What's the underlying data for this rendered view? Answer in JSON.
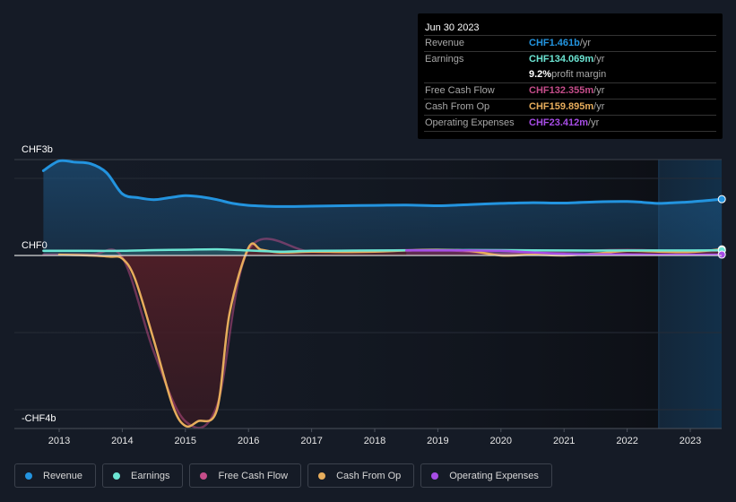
{
  "tooltip": {
    "date": "Jun 30 2023",
    "rows": [
      {
        "label": "Revenue",
        "value": "CHF1.461b",
        "unit": " /yr",
        "color": "#2394df"
      },
      {
        "label": "Earnings",
        "value": "CHF134.069m",
        "unit": " /yr",
        "color": "#6ce5d3"
      },
      {
        "label": "",
        "value": "9.2%",
        "unit": " profit margin",
        "color": "#ffffff"
      },
      {
        "label": "Free Cash Flow",
        "value": "CHF132.355m",
        "unit": " /yr",
        "color": "#c54d8a"
      },
      {
        "label": "Cash From Op",
        "value": "CHF159.895m",
        "unit": " /yr",
        "color": "#e7ad5c"
      },
      {
        "label": "Operating Expenses",
        "value": "CHF23.412m",
        "unit": " /yr",
        "color": "#a74de6"
      }
    ]
  },
  "legend": [
    {
      "label": "Revenue",
      "color": "#2394df"
    },
    {
      "label": "Earnings",
      "color": "#6ce5d3"
    },
    {
      "label": "Free Cash Flow",
      "color": "#c54d8a"
    },
    {
      "label": "Cash From Op",
      "color": "#e7ad5c"
    },
    {
      "label": "Operating Expenses",
      "color": "#a74de6"
    }
  ],
  "chart_data": {
    "type": "area",
    "title": "",
    "xlabel": "",
    "ylabel": "",
    "unit": "CHF billions",
    "y_tick_labels": [
      "CHF3b",
      "CHF0",
      "-CHF4b"
    ],
    "y_ticks": [
      2.5,
      0,
      -4
    ],
    "ylim": [
      -4.5,
      2.5
    ],
    "x_tick_labels": [
      "2013",
      "2014",
      "2015",
      "2016",
      "2017",
      "2018",
      "2019",
      "2020",
      "2021",
      "2022",
      "2023"
    ],
    "xlim": [
      2012.75,
      2023.5
    ],
    "forecast_shade_from": 2022.5,
    "grid": true,
    "legend_position": "bottom",
    "series": [
      {
        "name": "Revenue",
        "color": "#2394df",
        "x": [
          2012.75,
          2013.0,
          2013.25,
          2013.5,
          2013.75,
          2014.0,
          2014.25,
          2014.5,
          2014.75,
          2015.0,
          2015.25,
          2015.5,
          2015.75,
          2016.0,
          2016.5,
          2017.0,
          2017.5,
          2018.0,
          2018.5,
          2019.0,
          2019.5,
          2020.0,
          2020.5,
          2021.0,
          2021.5,
          2022.0,
          2022.25,
          2022.5,
          2022.75,
          2023.0,
          2023.5
        ],
        "values": [
          2.2,
          2.45,
          2.42,
          2.38,
          2.15,
          1.6,
          1.5,
          1.45,
          1.5,
          1.55,
          1.52,
          1.45,
          1.35,
          1.3,
          1.27,
          1.28,
          1.29,
          1.3,
          1.31,
          1.29,
          1.32,
          1.35,
          1.37,
          1.36,
          1.39,
          1.4,
          1.38,
          1.35,
          1.37,
          1.39,
          1.461
        ]
      },
      {
        "name": "Earnings",
        "color": "#6ce5d3",
        "x": [
          2012.75,
          2013.5,
          2014.0,
          2014.5,
          2015.0,
          2015.5,
          2016.0,
          2016.5,
          2017.0,
          2018.0,
          2019.0,
          2020.0,
          2021.0,
          2022.0,
          2023.0,
          2023.5
        ],
        "values": [
          0.12,
          0.12,
          0.12,
          0.14,
          0.15,
          0.16,
          0.13,
          0.1,
          0.12,
          0.13,
          0.14,
          0.14,
          0.13,
          0.13,
          0.13,
          0.134
        ]
      },
      {
        "name": "Free Cash Flow",
        "color": "#c54d8a",
        "x": [
          2012.75,
          2013.5,
          2014.0,
          2014.5,
          2015.0,
          2015.5,
          2016.0,
          2017.0,
          2018.0,
          2019.0,
          2020.0,
          2021.0,
          2022.0,
          2023.0,
          2023.5
        ],
        "values": [
          0.02,
          0.02,
          -0.05,
          -2.5,
          -4.3,
          -3.9,
          0.15,
          0.1,
          0.12,
          0.15,
          0.05,
          0.1,
          0.15,
          0.1,
          0.132
        ]
      },
      {
        "name": "Cash From Op",
        "color": "#e7ad5c",
        "x": [
          2013.0,
          2013.5,
          2013.8,
          2014.0,
          2014.2,
          2014.5,
          2014.8,
          2015.0,
          2015.2,
          2015.5,
          2015.7,
          2016.0,
          2016.2,
          2016.5,
          2017.0,
          2017.5,
          2018.0,
          2018.5,
          2019.0,
          2019.5,
          2020.0,
          2020.5,
          2021.0,
          2021.5,
          2022.0,
          2022.5,
          2023.0,
          2023.5
        ],
        "values": [
          0.02,
          0.0,
          -0.03,
          -0.08,
          -0.6,
          -2.2,
          -3.9,
          -4.42,
          -4.3,
          -4.0,
          -1.5,
          0.2,
          0.15,
          0.08,
          0.1,
          0.09,
          0.1,
          0.13,
          0.15,
          0.12,
          0.0,
          0.02,
          0.0,
          0.05,
          0.12,
          0.1,
          0.09,
          0.16
        ]
      },
      {
        "name": "Operating Expenses",
        "color": "#a74de6",
        "x": [
          2018.5,
          2019.0,
          2019.5,
          2020.0,
          2020.5,
          2021.0,
          2021.5,
          2022.0,
          2022.5,
          2023.0,
          2023.5
        ],
        "values": [
          0.13,
          0.13,
          0.13,
          0.12,
          0.08,
          0.04,
          0.03,
          0.03,
          0.02,
          0.02,
          0.023
        ]
      }
    ]
  }
}
